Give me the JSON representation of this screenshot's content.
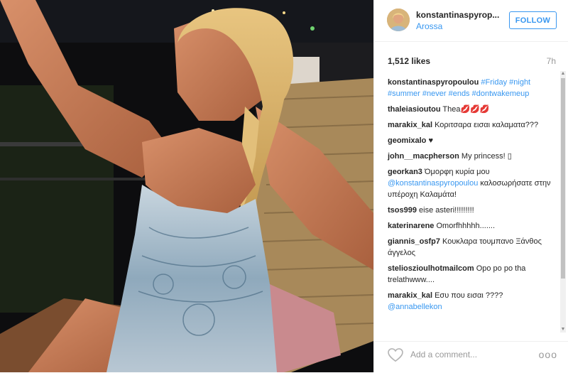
{
  "post": {
    "username": "konstantinaspyrop...",
    "location": "Arossa",
    "follow_label": "FOLLOW",
    "likes": "1,512 likes",
    "time": "7h"
  },
  "comments": [
    {
      "user": "konstantinaspyropoulou",
      "text": "",
      "tags": "#Friday #night #summer #never #ends #dontwakemeup"
    },
    {
      "user": "thaleiasioutou",
      "text": "Thea💋💋💋"
    },
    {
      "user": "marakix_kal",
      "text": "Κοριτσαρα εισαι καλαματα???"
    },
    {
      "user": "geomixalo",
      "text": "♥"
    },
    {
      "user": "john__macpherson",
      "text": "My princess! ▯"
    },
    {
      "user": "georkan3",
      "text": "Όμορφη κυρία μου",
      "mention": "@konstantinaspyropoulou",
      "text2": "καλοσωρήσατε στην υπέροχη Καλαμάτα!"
    },
    {
      "user": "tsos999",
      "text": "eise asteri!!!!!!!!!"
    },
    {
      "user": "katerinarene",
      "text": "Omorfhhhhh......."
    },
    {
      "user": "giannis_osfp7",
      "text": "Κουκλαρα τουμπανο Ξάνθος άγγελος"
    },
    {
      "user": "stelioszioulhotmailcom",
      "text": "Opo po po tha trelathwww...."
    },
    {
      "user": "marakix_kal",
      "text": "Εσυ που εισαι ????",
      "mention": "@annabellekon"
    }
  ],
  "footer": {
    "add_comment_placeholder": "Add a comment...",
    "more_label": "ooo"
  },
  "colors": {
    "accent": "#3897f0",
    "text": "#262626",
    "muted": "#999999"
  }
}
